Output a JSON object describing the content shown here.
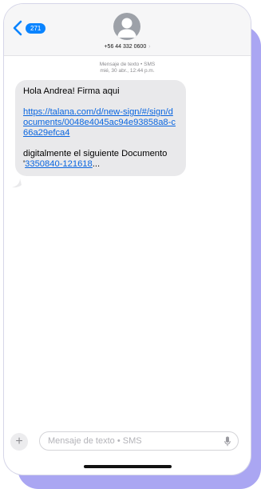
{
  "header": {
    "unread_count": "271",
    "contact_number": "+56 44 332 0600",
    "contact_chevron": "›"
  },
  "conversation": {
    "meta_line1": "Mensaje de texto • SMS",
    "meta_line2": "mié, 30 abr., 12:44 p.m.",
    "message": {
      "greeting": "Hola Andrea! Firma aqui",
      "link": "https://talana.com/d/new-sign/#/sign/documents/0048e4045ac94e93858a8-c66a29efca4",
      "body_text": "digitalmente el siguiente Documento",
      "doc_prefix": "'",
      "doc_link": "3350840-121618",
      "doc_suffix": "..."
    }
  },
  "composer": {
    "plus_label": "+",
    "placeholder": "Mensaje de texto • SMS"
  },
  "colors": {
    "accent": "#0a84ff",
    "link": "#0a66e0",
    "bubble": "#e9e9eb",
    "frame_shadow": "#aaa6f2"
  },
  "icons": {
    "back": "chevron-left-icon",
    "avatar": "person-icon",
    "add": "plus-icon",
    "mic": "microphone-icon"
  }
}
